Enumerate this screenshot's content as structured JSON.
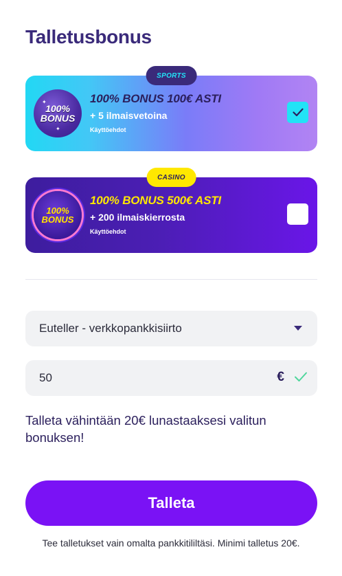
{
  "page": {
    "title": "Talletusbonus"
  },
  "bonuses": [
    {
      "tag": "SPORTS",
      "badge_top": "100%",
      "badge_bottom": "BONUS",
      "headline": "100% BONUS 100€ ASTI",
      "subline": "+ 5 ilmaisvetoina",
      "terms": "Käyttöehdot",
      "checked": true
    },
    {
      "tag": "CASINO",
      "badge_top": "100%",
      "badge_bottom": "BONUS",
      "headline": "100% BONUS 500€ ASTI",
      "subline": "+ 200 ilmaiskierrosta",
      "terms": "Käyttöehdot",
      "checked": false
    }
  ],
  "payment": {
    "selected": "Euteller - verkkopankkisiirto"
  },
  "amount": {
    "value": "50",
    "currency": "€"
  },
  "hint": "Talleta vähintään 20€ lunastaaksesi valitun bonuksen!",
  "submit_label": "Talleta",
  "footnote": "Tee talletukset vain omalta pankkitililtäsi. Minimi talletus 20€.",
  "colors": {
    "accent": "#7a12f5",
    "title": "#3a2a7a",
    "checkbox_checked": "#22e3f6",
    "casino_tag": "#ffe800"
  },
  "icons": [
    "chevron-down-icon",
    "check-icon",
    "checkmark-icon"
  ]
}
